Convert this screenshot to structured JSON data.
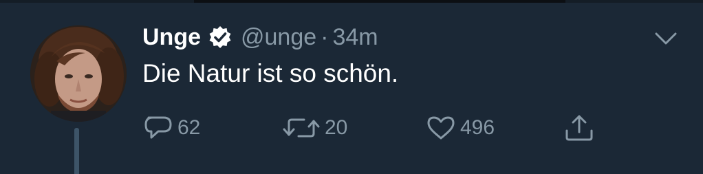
{
  "tweet": {
    "display_name": "Unge",
    "handle": "@unge",
    "separator": "·",
    "time": "34m",
    "text": "Die Natur ist so schön.",
    "verified": true
  },
  "actions": {
    "reply_count": "62",
    "retweet_count": "20",
    "like_count": "496"
  },
  "icons": {
    "verified": "verified-badge-icon",
    "caret": "chevron-down-icon",
    "reply": "reply-bubble-icon",
    "retweet": "retweet-arrows-icon",
    "like": "heart-icon",
    "share": "share-upload-icon"
  },
  "colors": {
    "background": "#1b2836",
    "text_primary": "#ffffff",
    "text_secondary": "#8899a6",
    "thread_line": "#3d5468"
  }
}
